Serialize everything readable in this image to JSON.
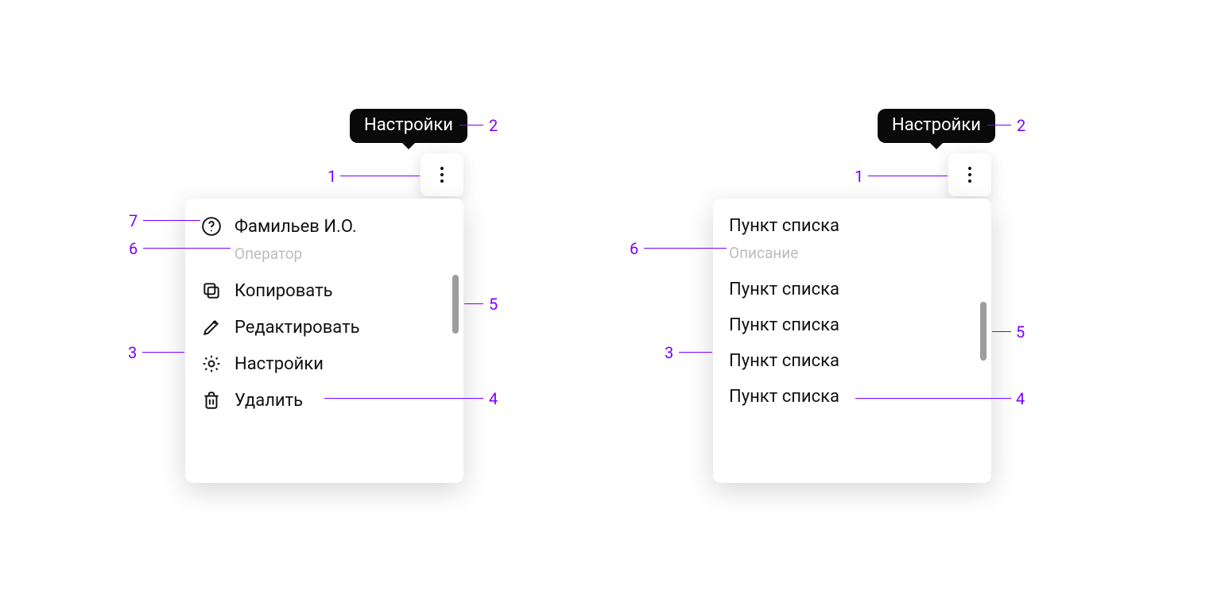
{
  "colors": {
    "annotation": "#7a00ff",
    "tooltip_bg": "#0a0a0a",
    "muted": "#bdbdbd"
  },
  "left": {
    "tooltip": "Настройки",
    "header": {
      "title": "Фамильев И.О.",
      "subtitle": "Оператор"
    },
    "items": [
      {
        "icon": "copy-icon",
        "label": "Копировать"
      },
      {
        "icon": "pencil-icon",
        "label": "Редактировать"
      },
      {
        "icon": "gear-icon",
        "label": "Настройки"
      },
      {
        "icon": "trash-icon",
        "label": "Удалить"
      }
    ]
  },
  "right": {
    "tooltip": "Настройки",
    "header": {
      "title": "Пункт списка",
      "subtitle": "Описание"
    },
    "items": [
      {
        "label": "Пункт списка"
      },
      {
        "label": "Пункт списка"
      },
      {
        "label": "Пункт списка"
      },
      {
        "label": "Пункт списка"
      }
    ]
  },
  "annotations": {
    "n1": "1",
    "n2": "2",
    "n3": "3",
    "n4": "4",
    "n5": "5",
    "n6": "6",
    "n7": "7"
  }
}
